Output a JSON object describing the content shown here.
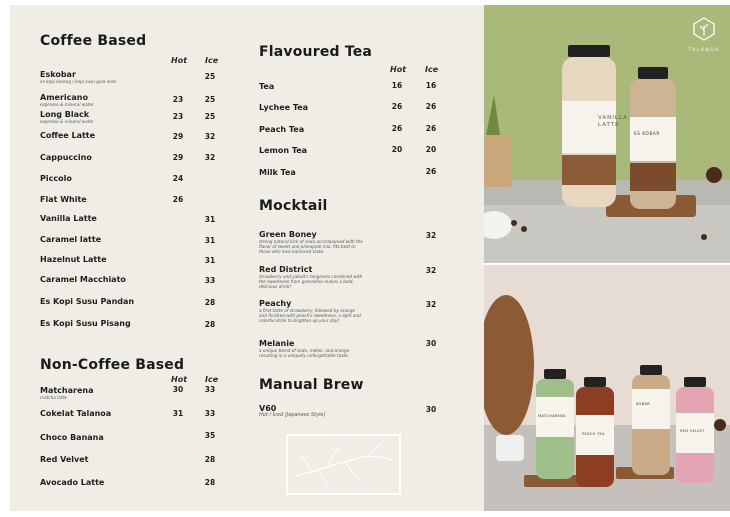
{
  "coffee": {
    "title": "Coffee Based",
    "hot": "Hot",
    "ice": "Ice",
    "items": [
      {
        "name": "Eskobar",
        "desc": "es kopi bareng / kopi susu gula aren",
        "hot": "",
        "ice": "25"
      },
      {
        "name": "Americano",
        "desc": "espresso & mineral water",
        "hot": "23",
        "ice": "25"
      },
      {
        "name": "Long Black",
        "desc": "espresso & mineral water",
        "hot": "23",
        "ice": "25"
      },
      {
        "name": "Coffee Latte",
        "desc": "",
        "hot": "29",
        "ice": "32"
      },
      {
        "name": "Cappuccino",
        "desc": "",
        "hot": "29",
        "ice": "32"
      },
      {
        "name": "Piccolo",
        "desc": "",
        "hot": "24",
        "ice": ""
      },
      {
        "name": "Flat White",
        "desc": "",
        "hot": "26",
        "ice": ""
      },
      {
        "name": "Vanilla Latte",
        "desc": "",
        "hot": "",
        "ice": "31"
      },
      {
        "name": "Caramel latte",
        "desc": "",
        "hot": "",
        "ice": "31"
      },
      {
        "name": "Hazelnut Latte",
        "desc": "",
        "hot": "",
        "ice": "31"
      },
      {
        "name": "Caramel Macchiato",
        "desc": "",
        "hot": "",
        "ice": "33"
      },
      {
        "name": "Es Kopi Susu Pandan",
        "desc": "",
        "hot": "",
        "ice": "28"
      },
      {
        "name": "Es Kopi Susu Pisang",
        "desc": "",
        "hot": "",
        "ice": "28"
      }
    ]
  },
  "noncoffee": {
    "title": "Non-Coffee Based",
    "hot": "Hot",
    "ice": "Ice",
    "items": [
      {
        "name": "Matcharena",
        "desc": "matcha latte",
        "hot": "30",
        "ice": "33"
      },
      {
        "name": "Cokelat Talanoa",
        "desc": "",
        "hot": "31",
        "ice": "33"
      },
      {
        "name": "Choco Banana",
        "desc": "",
        "hot": "",
        "ice": "35"
      },
      {
        "name": "Red Velvet",
        "desc": "",
        "hot": "",
        "ice": "28"
      },
      {
        "name": "Avocado Latte",
        "desc": "",
        "hot": "",
        "ice": "28"
      }
    ]
  },
  "tea": {
    "title": "Flavoured Tea",
    "hot": "Hot",
    "ice": "Ice",
    "items": [
      {
        "name": "Tea",
        "hot": "16",
        "ice": "16"
      },
      {
        "name": "Lychee Tea",
        "hot": "26",
        "ice": "26"
      },
      {
        "name": "Peach Tea",
        "hot": "26",
        "ice": "26"
      },
      {
        "name": "Lemon Tea",
        "hot": "20",
        "ice": "20"
      },
      {
        "name": "Milk Tea",
        "hot": "",
        "ice": "26"
      }
    ]
  },
  "mocktail": {
    "title": "Mocktail",
    "items": [
      {
        "name": "Green Boney",
        "desc1": "strong natural kick of soda accompanied with the",
        "desc2": "flavor of sweet and pineapple mix. fits best to",
        "desc3": "those who love balanced taste.",
        "price": "32"
      },
      {
        "name": "Red District",
        "desc1": "strawberry and yakult's tanginess combined with",
        "desc2": "the sweetness from grenadine makes a bold,",
        "desc3": "delicious drink!",
        "price": "32"
      },
      {
        "name": "Peachy",
        "desc1": "a first taste of strawberry, followed by orange",
        "desc2": "and finished with peach's sweetness, a light and",
        "desc3": "colorful drink to brighten up your day!",
        "price": "32"
      },
      {
        "name": "Melanie",
        "desc1": "a unique blend of soda, melon, and orange",
        "desc2": "resulting in a uniquely unforgettable taste.",
        "desc3": "",
        "price": "30"
      }
    ]
  },
  "brew": {
    "title": "Manual Brew",
    "items": [
      {
        "name": "V60",
        "desc": "Hot / Iced (Japanese Style)",
        "price": "30"
      }
    ]
  },
  "brand": {
    "name": "TALANOA"
  },
  "bottles": {
    "vanilla": "VANILLA LATTE",
    "eskobar": "ES KOBAR",
    "matcharena": "MATCHARENA",
    "peach": "PEACH TEA",
    "kobar": "KOBAR",
    "redvelvet": "RED VELVET"
  },
  "colors": {
    "paper": "#efede6",
    "text": "#1c1c1c",
    "wall_top": "#a9b97a",
    "wall_bottom": "#e7dcd3"
  }
}
